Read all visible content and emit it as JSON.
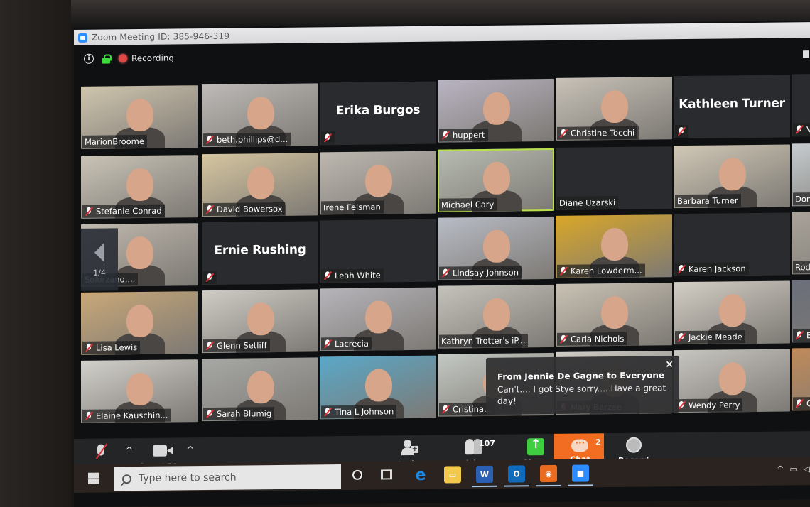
{
  "window": {
    "title": "Zoom Meeting ID: 385-946-319",
    "recording_label": "Recording",
    "icons": {
      "info": "info-icon",
      "lock": "lock-icon",
      "record": "recording-icon"
    }
  },
  "gallery": {
    "page_indicator": "1/4",
    "rows": [
      [
        {
          "name": "MarionBroome",
          "video": true,
          "muted": false,
          "bg": "#cfc5ae"
        },
        {
          "name": "beth.phillips@d...",
          "video": true,
          "muted": true,
          "bg": "#bdbab7"
        },
        {
          "name": "Erika Burgos",
          "video": false,
          "muted": true,
          "show_label": false
        },
        {
          "name": "huppert",
          "video": true,
          "muted": true,
          "bg": "#b9b4c2"
        },
        {
          "name": "Christine Tocchi",
          "video": true,
          "muted": true,
          "bg": "#c8c2b8"
        },
        {
          "name": "Kathleen Turner",
          "video": false,
          "muted": true,
          "show_label": false
        },
        {
          "name": "Vals...",
          "video": false,
          "muted": true
        }
      ],
      [
        {
          "name": "Stefanie Conrad",
          "video": true,
          "muted": true,
          "bg": "#c9c3b6"
        },
        {
          "name": "David Bowersox",
          "video": true,
          "muted": true,
          "bg": "#d6c6a0"
        },
        {
          "name": "Irene Felsman",
          "video": true,
          "muted": false,
          "bg": "#bdb8b0"
        },
        {
          "name": "Michael Cary",
          "video": true,
          "muted": false,
          "speaking": true,
          "bg": "#b7bcb2"
        },
        {
          "name": "Diane Uzarski",
          "video": false,
          "muted": false
        },
        {
          "name": "Barbara Turner",
          "video": true,
          "muted": false,
          "bg": "#d0c8b6"
        },
        {
          "name": "Donna...",
          "video": true,
          "muted": false,
          "bg": "#c6cccf"
        }
      ],
      [
        {
          "name": "Solorzano,...",
          "video": true,
          "muted": false,
          "bg": "#bfb8ae"
        },
        {
          "name": "Ernie Rushing",
          "video": false,
          "muted": true,
          "show_label": false
        },
        {
          "name": "Leah White",
          "video": false,
          "muted": true
        },
        {
          "name": "Lindsay Johnson",
          "video": true,
          "muted": true,
          "bg": "#b8bcc6"
        },
        {
          "name": "Karen Lowderm...",
          "video": true,
          "muted": true,
          "bg": "#d9a728"
        },
        {
          "name": "Karen Jackson",
          "video": false,
          "muted": true
        },
        {
          "name": "Rodne...",
          "video": true,
          "muted": false,
          "bg": "#a9a39a"
        }
      ],
      [
        {
          "name": "Lisa Lewis",
          "video": true,
          "muted": true,
          "bg": "#c9a878"
        },
        {
          "name": "Glenn Setliff",
          "video": true,
          "muted": true,
          "bg": "#cfccc6"
        },
        {
          "name": "Lacrecia",
          "video": true,
          "muted": true,
          "bg": "#b6b4ba"
        },
        {
          "name": "Kathryn Trotter's iP...",
          "video": true,
          "muted": false,
          "bg": "#c5c2bb"
        },
        {
          "name": "Carla Nichols",
          "video": true,
          "muted": true,
          "bg": "#c9c2b4"
        },
        {
          "name": "Jackie Meade",
          "video": true,
          "muted": true,
          "bg": "#d3cfc6"
        },
        {
          "name": "Br...",
          "video": true,
          "muted": true,
          "bg": "#6b6f7a"
        }
      ],
      [
        {
          "name": "Elaine Kauschin...",
          "video": true,
          "muted": true,
          "bg": "#d2d0cb"
        },
        {
          "name": "Sarah Blumig",
          "video": true,
          "muted": true,
          "bg": "#a7a8a5"
        },
        {
          "name": "Tina L Johnson",
          "video": true,
          "muted": true,
          "bg": "#5aa8c8"
        },
        {
          "name": "Cristina...",
          "video": true,
          "muted": true,
          "bg": "#c4c9c3"
        },
        {
          "name": "Mary Barzee",
          "video": true,
          "muted": true,
          "bg": "#d0ccc6"
        },
        {
          "name": "Wendy Perry",
          "video": true,
          "muted": true,
          "bg": "#c8c6c0"
        },
        {
          "name": "C...",
          "video": true,
          "muted": true,
          "bg": "#c08a5a"
        }
      ]
    ]
  },
  "chat_toast": {
    "from": "From Jennie De Gagne to Everyone",
    "message": "Can't.... I got Stye sorry.... Have a great day!",
    "close_label": "×"
  },
  "toolbar": {
    "unmute": "Unmute",
    "stop_video": "Stop Video",
    "invite": "Invite",
    "participants": "Participants",
    "participant_count": "107",
    "share": "Share",
    "chat": "Chat",
    "chat_badge": "2",
    "record": "Record",
    "caret": "^",
    "accent_color": "#f26d21",
    "share_color": "#3fce3f"
  },
  "taskbar": {
    "search_placeholder": "Type here to search",
    "apps": [
      {
        "name": "edge",
        "glyph": "e",
        "color": "#1e88e5"
      },
      {
        "name": "file-explorer",
        "glyph": "▭",
        "color": "#f2c94c"
      },
      {
        "name": "word",
        "glyph": "W",
        "color": "#2b5fb4"
      },
      {
        "name": "outlook",
        "glyph": "O",
        "color": "#0f6cbd"
      },
      {
        "name": "firefox",
        "glyph": "◉",
        "color": "#e86b1f"
      },
      {
        "name": "zoom",
        "glyph": "■",
        "color": "#2d8cff"
      }
    ],
    "tray": {
      "chevron": "^",
      "battery": "▭",
      "volume": "◁"
    }
  }
}
